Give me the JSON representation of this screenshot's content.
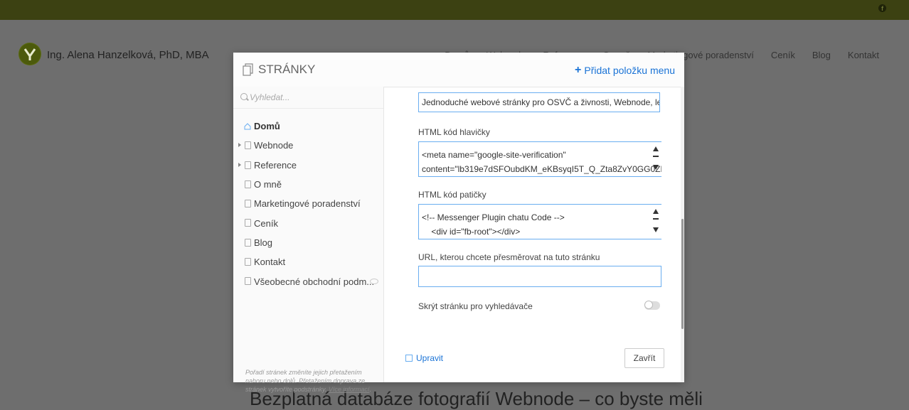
{
  "site": {
    "brand": "Ing. Alena Hanzelková, PhD, MBA",
    "nav": [
      "Domů",
      "Webnode",
      "Reference",
      "O mně",
      "Marketingové poradenství",
      "Ceník",
      "Blog",
      "Kontakt"
    ],
    "hero_text": "Bezplatná databáze fotografií Webnode – co byste měli"
  },
  "modal": {
    "title": "STRÁNKY",
    "add_item_label": "Přidat položku menu",
    "search_placeholder": "Vyhledat...",
    "pages": [
      {
        "label": "Domů",
        "icon": "home-icon",
        "active": true,
        "has_children": false
      },
      {
        "label": "Webnode",
        "icon": "doc-icon",
        "active": false,
        "has_children": true
      },
      {
        "label": "Reference",
        "icon": "doc-icon",
        "active": false,
        "has_children": true
      },
      {
        "label": "O mně",
        "icon": "doc-icon",
        "active": false,
        "has_children": false
      },
      {
        "label": "Marketingové poradenství",
        "icon": "doc-icon",
        "active": false,
        "has_children": false
      },
      {
        "label": "Ceník",
        "icon": "doc-icon",
        "active": false,
        "has_children": false
      },
      {
        "label": "Blog",
        "icon": "doc-icon",
        "active": false,
        "has_children": false
      },
      {
        "label": "Kontakt",
        "icon": "doc-icon",
        "active": false,
        "has_children": false
      },
      {
        "label": "Všeobecné obchodní podm...",
        "icon": "doc-icon",
        "active": false,
        "has_children": false,
        "hidden": true
      }
    ],
    "help_text": "Pořadí stránek změníte jejich přetažením nahoru nebo dolů. Přetažením doprava ze stránek vytvoříte podstránky.",
    "help_link": "Více informací",
    "fields": {
      "description_value": "Jednoduché webové stránky pro OSVČ a živnosti, Webnode, levné w",
      "header_label": "HTML kód hlavičky",
      "header_code": [
        "<meta name=\"google-site-verification\"",
        "content=\"lb319e7dSFOubdKM_eKBsyqI5T_Q_Zta8ZvY0GG0ZM0",
        "\" />"
      ],
      "footer_label": "HTML kód patičky",
      "footer_code": [
        "<!-- Messenger Plugin chatu Code -->",
        "    <div id=\"fb-root\"></div>"
      ],
      "redirect_label": "URL, kterou chcete přesměrovat na tuto stránku",
      "redirect_value": "",
      "hide_label": "Skrýt stránku pro vyhledávače",
      "hide_enabled": false
    },
    "edit_label": "Upravit",
    "close_label": "Zavřít"
  },
  "colors": {
    "topbar": "#3c4112",
    "accent": "#1a73d6",
    "input_border": "#6aaef0"
  }
}
